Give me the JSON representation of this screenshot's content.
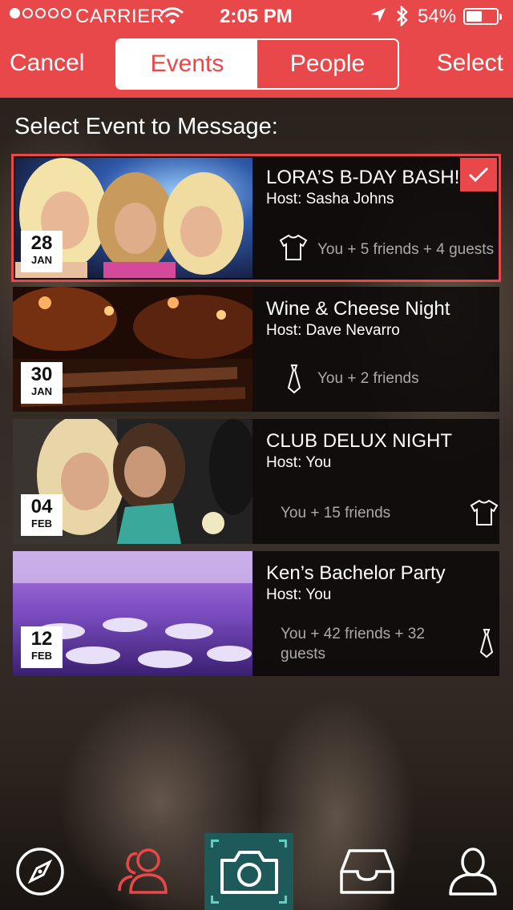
{
  "status_bar": {
    "carrier": "CARRIER",
    "time": "2:05 PM",
    "battery": "54%",
    "battery_level": 0.54,
    "signal_bars": 1
  },
  "header": {
    "cancel_label": "Cancel",
    "select_label": "Select",
    "segments": [
      "Events",
      "People"
    ],
    "active_segment": "Events",
    "accent_color": "#e8484a"
  },
  "section_title": "Select Event to Message:",
  "events": [
    {
      "title": "LORA’S B-DAY BASH!",
      "host": "Host: Sasha Johns",
      "attendance": "You + 5 friends + 4 guests",
      "day": "28",
      "month": "JAN",
      "dress_icon": "tshirt-icon",
      "selected": true
    },
    {
      "title": "Wine & Cheese Night",
      "host": "Host: Dave Nevarro",
      "attendance": "You + 2 friends",
      "day": "30",
      "month": "JAN",
      "dress_icon": "tie-icon",
      "selected": false
    },
    {
      "title": "CLUB DELUX NIGHT",
      "host": "Host: You",
      "attendance": "You + 15 friends",
      "day": "04",
      "month": "FEB",
      "dress_icon": "tshirt-icon",
      "selected": false
    },
    {
      "title": "Ken’s Bachelor Party",
      "host": "Host: You",
      "attendance": "You + 42 friends + 32 guests",
      "day": "12",
      "month": "FEB",
      "dress_icon": "tie-icon",
      "selected": false
    }
  ],
  "tab_bar": {
    "items": [
      "compass-icon",
      "people-icon",
      "camera-icon",
      "inbox-icon",
      "profile-icon"
    ],
    "active": "camera-icon"
  }
}
